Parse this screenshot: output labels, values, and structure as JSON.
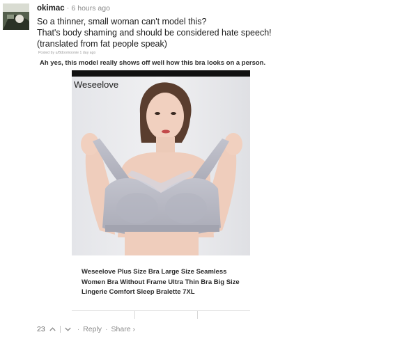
{
  "comment": {
    "username": "okimac",
    "time": "6 hours ago",
    "lines": [
      "So a thinner, small woman can't model this?",
      "That's body shaming and should be considered hate speech!",
      "(translated from fat people speak)"
    ]
  },
  "embedded": {
    "posted_by": "Posted by u/Bdoomoonie 1 day ago",
    "title": "Ah yes, this model really shows off well how this bra looks on a person.",
    "brand": "Weseelove",
    "caption": "Weseelove Plus Size Bra Large Size Seamless Women Bra Without Frame Ultra Thin Bra Big Size Lingerie Comfort Sleep Bralette 7XL"
  },
  "actions": {
    "score": "23",
    "reply_label": "Reply",
    "share_label": "Share ›"
  },
  "icons": {
    "upvote": "chevron-up-icon",
    "downvote": "chevron-down-icon"
  },
  "colors": {
    "text": "#1a1a1a",
    "muted": "#8a8a8a",
    "bra": "#b8b9c4"
  }
}
